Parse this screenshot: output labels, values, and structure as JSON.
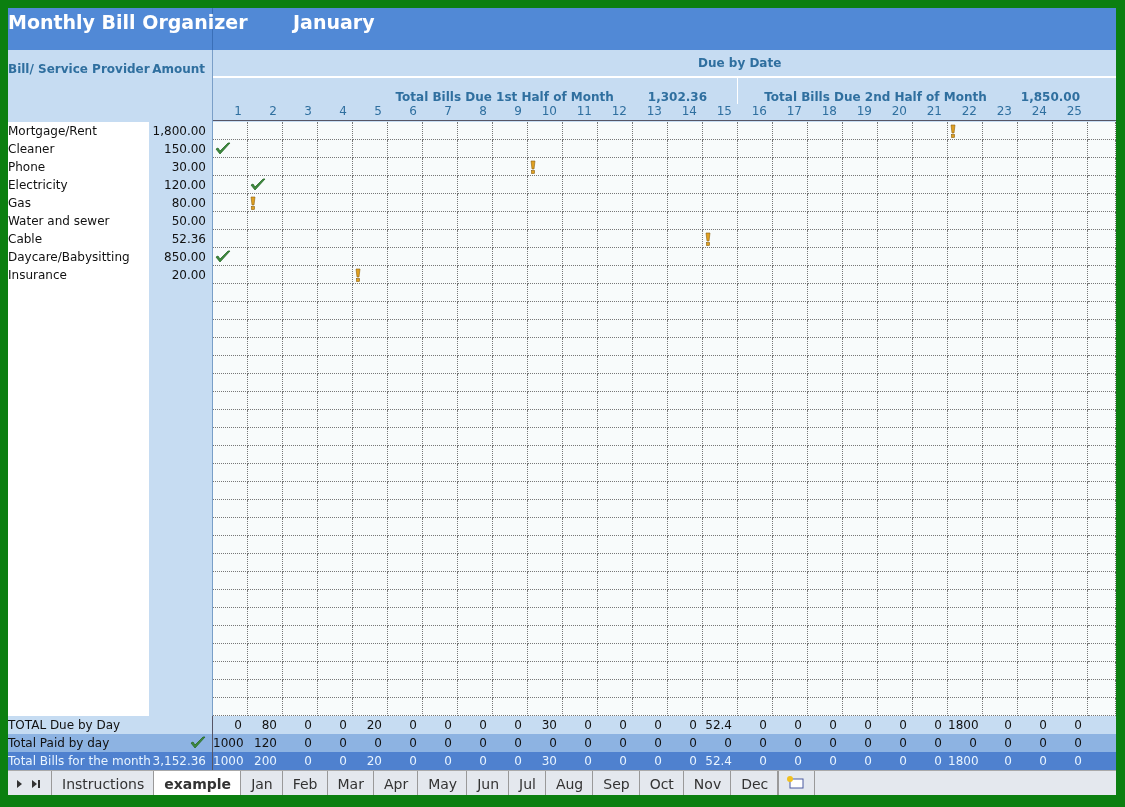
{
  "title": "Monthly Bill Organizer",
  "month": "January",
  "columns": {
    "provider": "Bill/ Service Provider",
    "amount": "Amount",
    "due_by_date": "Due by Date"
  },
  "half_totals": [
    {
      "label": "Total Bills Due 1st Half of Month",
      "value": "1,302.36"
    },
    {
      "label": "Total Bills Due 2nd Half of Month",
      "value": "1,850.00"
    }
  ],
  "days": [
    "1",
    "2",
    "3",
    "4",
    "5",
    "6",
    "7",
    "8",
    "9",
    "10",
    "11",
    "12",
    "13",
    "14",
    "15",
    "16",
    "17",
    "18",
    "19",
    "20",
    "21",
    "22",
    "23",
    "24",
    "25"
  ],
  "bills": [
    {
      "name": "Mortgage/Rent",
      "amount": "1,800.00",
      "cells": [
        {
          "kind": "empty"
        },
        {
          "kind": "empty"
        },
        {
          "kind": "empty"
        },
        {
          "kind": "empty"
        },
        {
          "kind": "empty"
        },
        {
          "kind": "empty"
        },
        {
          "kind": "empty"
        },
        {
          "kind": "empty"
        },
        {
          "kind": "empty"
        },
        {
          "kind": "empty"
        },
        {
          "kind": "empty"
        },
        {
          "kind": "empty"
        },
        {
          "kind": "empty"
        },
        {
          "kind": "empty"
        },
        {
          "kind": "empty"
        },
        {
          "kind": "empty"
        },
        {
          "kind": "empty"
        },
        {
          "kind": "empty"
        },
        {
          "kind": "empty"
        },
        {
          "kind": "empty"
        },
        {
          "kind": "empty"
        },
        {
          "kind": "alert"
        },
        {
          "kind": "empty"
        },
        {
          "kind": "empty"
        },
        {
          "kind": "empty"
        }
      ]
    },
    {
      "name": "Cleaner",
      "amount": "150.00",
      "cells": [
        {
          "kind": "check"
        },
        {
          "kind": "empty"
        },
        {
          "kind": "empty"
        },
        {
          "kind": "empty"
        },
        {
          "kind": "empty"
        },
        {
          "kind": "empty"
        },
        {
          "kind": "empty"
        },
        {
          "kind": "empty"
        },
        {
          "kind": "empty"
        },
        {
          "kind": "empty"
        },
        {
          "kind": "empty"
        },
        {
          "kind": "empty"
        },
        {
          "kind": "empty"
        },
        {
          "kind": "empty"
        },
        {
          "kind": "empty"
        },
        {
          "kind": "empty"
        },
        {
          "kind": "empty"
        },
        {
          "kind": "empty"
        },
        {
          "kind": "empty"
        },
        {
          "kind": "empty"
        },
        {
          "kind": "empty"
        },
        {
          "kind": "empty"
        },
        {
          "kind": "empty"
        },
        {
          "kind": "empty"
        },
        {
          "kind": "empty"
        }
      ]
    },
    {
      "name": "Phone",
      "amount": "30.00",
      "cells": [
        {
          "kind": "empty"
        },
        {
          "kind": "empty"
        },
        {
          "kind": "empty"
        },
        {
          "kind": "empty"
        },
        {
          "kind": "empty"
        },
        {
          "kind": "empty"
        },
        {
          "kind": "empty"
        },
        {
          "kind": "empty"
        },
        {
          "kind": "empty"
        },
        {
          "kind": "alert"
        },
        {
          "kind": "empty"
        },
        {
          "kind": "empty"
        },
        {
          "kind": "empty"
        },
        {
          "kind": "empty"
        },
        {
          "kind": "empty"
        },
        {
          "kind": "empty"
        },
        {
          "kind": "empty"
        },
        {
          "kind": "empty"
        },
        {
          "kind": "empty"
        },
        {
          "kind": "empty"
        },
        {
          "kind": "empty"
        },
        {
          "kind": "empty"
        },
        {
          "kind": "empty"
        },
        {
          "kind": "empty"
        },
        {
          "kind": "empty"
        }
      ]
    },
    {
      "name": "Electricity",
      "amount": "120.00",
      "cells": [
        {
          "kind": "empty"
        },
        {
          "kind": "check"
        },
        {
          "kind": "empty"
        },
        {
          "kind": "empty"
        },
        {
          "kind": "empty"
        },
        {
          "kind": "empty"
        },
        {
          "kind": "empty"
        },
        {
          "kind": "empty"
        },
        {
          "kind": "empty"
        },
        {
          "kind": "empty"
        },
        {
          "kind": "empty"
        },
        {
          "kind": "empty"
        },
        {
          "kind": "empty"
        },
        {
          "kind": "empty"
        },
        {
          "kind": "empty"
        },
        {
          "kind": "empty"
        },
        {
          "kind": "empty"
        },
        {
          "kind": "empty"
        },
        {
          "kind": "empty"
        },
        {
          "kind": "empty"
        },
        {
          "kind": "empty"
        },
        {
          "kind": "empty"
        },
        {
          "kind": "empty"
        },
        {
          "kind": "empty"
        },
        {
          "kind": "empty"
        }
      ]
    },
    {
      "name": "Gas",
      "amount": "80.00",
      "cells": [
        {
          "kind": "empty"
        },
        {
          "kind": "alert"
        },
        {
          "kind": "empty"
        },
        {
          "kind": "empty"
        },
        {
          "kind": "empty"
        },
        {
          "kind": "empty"
        },
        {
          "kind": "empty"
        },
        {
          "kind": "empty"
        },
        {
          "kind": "empty"
        },
        {
          "kind": "empty"
        },
        {
          "kind": "empty"
        },
        {
          "kind": "empty"
        },
        {
          "kind": "empty"
        },
        {
          "kind": "empty"
        },
        {
          "kind": "empty"
        },
        {
          "kind": "empty"
        },
        {
          "kind": "empty"
        },
        {
          "kind": "empty"
        },
        {
          "kind": "empty"
        },
        {
          "kind": "empty"
        },
        {
          "kind": "empty"
        },
        {
          "kind": "empty"
        },
        {
          "kind": "empty"
        },
        {
          "kind": "empty"
        },
        {
          "kind": "empty"
        }
      ]
    },
    {
      "name": "Water and sewer",
      "amount": "50.00"
    },
    {
      "name": "Cable",
      "amount": "52.36",
      "cells": [
        {
          "kind": "empty"
        },
        {
          "kind": "empty"
        },
        {
          "kind": "empty"
        },
        {
          "kind": "empty"
        },
        {
          "kind": "empty"
        },
        {
          "kind": "empty"
        },
        {
          "kind": "empty"
        },
        {
          "kind": "empty"
        },
        {
          "kind": "empty"
        },
        {
          "kind": "empty"
        },
        {
          "kind": "empty"
        },
        {
          "kind": "empty"
        },
        {
          "kind": "empty"
        },
        {
          "kind": "empty"
        },
        {
          "kind": "alert"
        },
        {
          "kind": "empty"
        },
        {
          "kind": "empty"
        },
        {
          "kind": "empty"
        },
        {
          "kind": "empty"
        },
        {
          "kind": "empty"
        },
        {
          "kind": "empty"
        },
        {
          "kind": "empty"
        },
        {
          "kind": "empty"
        },
        {
          "kind": "empty"
        },
        {
          "kind": "empty"
        }
      ]
    },
    {
      "name": "Daycare/Babysitting",
      "amount": "850.00",
      "cells": [
        {
          "kind": "check"
        },
        {
          "kind": "empty"
        },
        {
          "kind": "empty"
        },
        {
          "kind": "empty"
        },
        {
          "kind": "empty"
        },
        {
          "kind": "empty"
        },
        {
          "kind": "empty"
        },
        {
          "kind": "empty"
        },
        {
          "kind": "empty"
        },
        {
          "kind": "empty"
        },
        {
          "kind": "empty"
        },
        {
          "kind": "empty"
        },
        {
          "kind": "empty"
        },
        {
          "kind": "empty"
        },
        {
          "kind": "empty"
        },
        {
          "kind": "empty"
        },
        {
          "kind": "empty"
        },
        {
          "kind": "empty"
        },
        {
          "kind": "empty"
        },
        {
          "kind": "empty"
        },
        {
          "kind": "empty"
        },
        {
          "kind": "empty"
        },
        {
          "kind": "empty"
        },
        {
          "kind": "empty"
        },
        {
          "kind": "empty"
        }
      ]
    },
    {
      "name": "Insurance",
      "amount": "20.00",
      "cells": [
        {
          "kind": "empty"
        },
        {
          "kind": "empty"
        },
        {
          "kind": "empty"
        },
        {
          "kind": "empty"
        },
        {
          "kind": "alert"
        },
        {
          "kind": "empty"
        },
        {
          "kind": "empty"
        },
        {
          "kind": "empty"
        },
        {
          "kind": "empty"
        },
        {
          "kind": "empty"
        },
        {
          "kind": "empty"
        },
        {
          "kind": "empty"
        },
        {
          "kind": "empty"
        },
        {
          "kind": "empty"
        },
        {
          "kind": "empty"
        },
        {
          "kind": "empty"
        },
        {
          "kind": "empty"
        },
        {
          "kind": "empty"
        },
        {
          "kind": "empty"
        },
        {
          "kind": "empty"
        },
        {
          "kind": "empty"
        },
        {
          "kind": "empty"
        },
        {
          "kind": "empty"
        },
        {
          "kind": "empty"
        },
        {
          "kind": "empty"
        }
      ]
    }
  ],
  "totals": [
    {
      "kind": "due",
      "label": "TOTAL Due by Day",
      "values": [
        "0",
        "80",
        "0",
        "0",
        "20",
        "0",
        "0",
        "0",
        "0",
        "30",
        "0",
        "0",
        "0",
        "0",
        "52.4",
        "0",
        "0",
        "0",
        "0",
        "0",
        "0",
        "1800",
        "0",
        "0",
        "0"
      ]
    },
    {
      "kind": "paid",
      "label": "Total Paid by day",
      "checked": true,
      "values": [
        "1000",
        "120",
        "0",
        "0",
        "0",
        "0",
        "0",
        "0",
        "0",
        "0",
        "0",
        "0",
        "0",
        "0",
        "0",
        "0",
        "0",
        "0",
        "0",
        "0",
        "0",
        "0",
        "0",
        "0",
        "0"
      ]
    },
    {
      "kind": "month",
      "label": "Total Bills for the month",
      "amount": "3,152.36",
      "values": [
        "1000",
        "200",
        "0",
        "0",
        "20",
        "0",
        "0",
        "0",
        "0",
        "30",
        "0",
        "0",
        "0",
        "0",
        "52.4",
        "0",
        "0",
        "0",
        "0",
        "0",
        "0",
        "1800",
        "0",
        "0",
        "0"
      ]
    }
  ],
  "sheet_tabs": [
    {
      "label": "Instructions",
      "selected": false
    },
    {
      "label": "example",
      "selected": true
    },
    {
      "label": "Jan",
      "selected": false
    },
    {
      "label": "Feb",
      "selected": false
    },
    {
      "label": "Mar",
      "selected": false
    },
    {
      "label": "Apr",
      "selected": false
    },
    {
      "label": "May",
      "selected": false
    },
    {
      "label": "Jun",
      "selected": false
    },
    {
      "label": "Jul",
      "selected": false
    },
    {
      "label": "Aug",
      "selected": false
    },
    {
      "label": "Sep",
      "selected": false
    },
    {
      "label": "Oct",
      "selected": false
    },
    {
      "label": "Nov",
      "selected": false
    },
    {
      "label": "Dec",
      "selected": false
    }
  ]
}
